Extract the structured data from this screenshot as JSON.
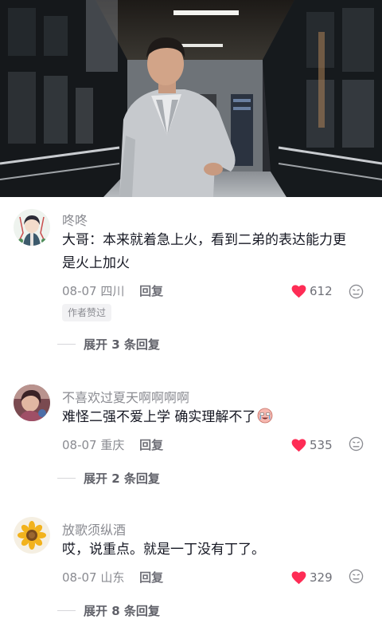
{
  "comments": [
    {
      "username": "咚咚",
      "text": "大哥：本来就着急上火，看到二弟的表达能力更是火上加火",
      "date": "08-07",
      "location": "四川",
      "reply_label": "回复",
      "likes": "612",
      "badge": "作者赞过",
      "expand_label": "展开 3 条回复",
      "avatar_icon": "anime-avatar-icon"
    },
    {
      "username": "不喜欢过夏天啊啊啊啊",
      "text": "难怪二强不爱上学 确实理解不了",
      "date": "08-07",
      "location": "重庆",
      "reply_label": "回复",
      "likes": "535",
      "expand_label": "展开 2 条回复",
      "text_emoji": "crying-face-emoji",
      "avatar_icon": "photo-avatar-icon"
    },
    {
      "username": "放歌须纵酒",
      "text": "哎，说重点。就是一丁没有丁了。",
      "date": "08-07",
      "location": "山东",
      "reply_label": "回复",
      "likes": "329",
      "expand_label": "展开 8 条回复",
      "avatar_icon": "sunflower-avatar-icon"
    }
  ],
  "colors": {
    "heart": "#fe2c55",
    "secondary_text": "#8a8b91",
    "primary_text": "#161823"
  }
}
